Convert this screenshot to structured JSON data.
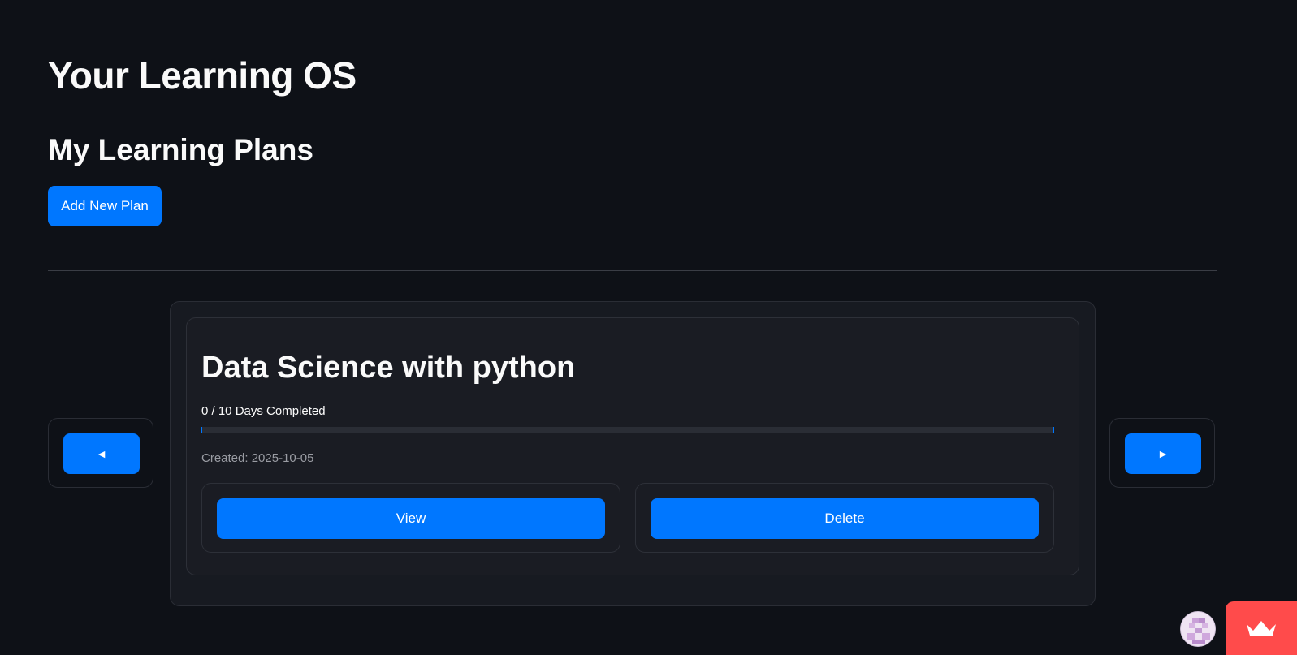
{
  "app": {
    "title": "Your Learning OS"
  },
  "plans_section": {
    "heading": "My Learning Plans",
    "add_button_label": "Add New Plan"
  },
  "carousel": {
    "prev_label": "◄",
    "next_label": "►",
    "plan": {
      "title": "Data Science with python",
      "progress_text": "0 / 10 Days Completed",
      "progress_fraction": 0,
      "created_text": "Created: 2025-10-05",
      "view_label": "View",
      "delete_label": "Delete"
    }
  },
  "colors": {
    "background": "#0e1117",
    "accent": "#0077ff",
    "badge": "#ff4b4b"
  },
  "icons": {
    "avatar": "user-avatar-icon",
    "badge": "streamlit-crown-icon"
  }
}
